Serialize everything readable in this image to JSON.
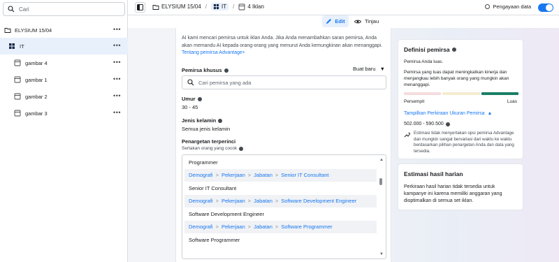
{
  "sidebar": {
    "search_placeholder": "Cari",
    "campaign": "ELYSIUM 15/04",
    "adset": "IT",
    "ads": [
      "gambar 4",
      "gambar 1",
      "gambar 2",
      "gambar 3"
    ],
    "more": "•••"
  },
  "topbar": {
    "campaign": "ELYSIUM 15/04",
    "adset": "IT",
    "ads_count": "4 Iklan",
    "enrichment": "Pengayaan data"
  },
  "modes": {
    "edit": "Edit",
    "review": "Tinjau"
  },
  "form": {
    "intro": "AI kami mencari pemirsa untuk iklan Anda. Jika Anda menambahkan saran pemirsa, Anda akan memandu AI kepada orang-orang yang menurut Anda kemungkinan akan menanggapi.",
    "intro_link": "Tentang pemirsa Advantage+",
    "custom_audience_label": "Pemirsa khusus",
    "create_new": "Buat baru",
    "audience_search_placeholder": "Cari pemirsa yang ada",
    "age_label": "Umur",
    "age_value": "30 - 45",
    "gender_label": "Jenis kelamin",
    "gender_value": "Semua jenis kelamin",
    "detailed_label": "Penargetan terperinci",
    "detailed_sub": "Sertakan orang yang cocok",
    "detailed_rows": [
      {
        "kind": "term",
        "text": "Programmer"
      },
      {
        "kind": "path",
        "parts": [
          "Demografi",
          "Pekerjaan",
          "Jabatan",
          "Senior IT Consultant"
        ]
      },
      {
        "kind": "term",
        "text": "Senior IT Consultant"
      },
      {
        "kind": "path",
        "parts": [
          "Demografi",
          "Pekerjaan",
          "Jabatan",
          "Software Development Engineer"
        ]
      },
      {
        "kind": "term",
        "text": "Software Development Engineer"
      },
      {
        "kind": "path",
        "parts": [
          "Demografi",
          "Pekerjaan",
          "Jabatan",
          "Software Programmer"
        ]
      },
      {
        "kind": "term",
        "text": "Software Programmer"
      }
    ],
    "path_sep": ">"
  },
  "definition_card": {
    "title": "Definisi pemirsa",
    "broad": "Pemirsa Anda luas.",
    "desc": "Pemirsa yang luas dapat meningkatkan kinerja dan menjangkau lebih banyak orang yang mungkin akan menanggapi.",
    "meter_colors": [
      "#f5dcdc",
      "#f4ecd0",
      "#1a7f64"
    ],
    "narrow": "Persempit",
    "wide": "Luas",
    "show_estimate": "Tampilkan Perkiraan Ukuran Pemirsa",
    "range": "502.000 - 590.500",
    "note_before": "Estimasi tidak menyertakan opsi pemirsa ",
    "note_strong": "Advantage",
    "note_after": " dan mungkin sangat bervariasi dari waktu ke waktu berdasarkan pilihan penargetan Anda dan data yang tersedia."
  },
  "daily_card": {
    "title": "Estimasi hasil harian",
    "text": "Perkiraan hasil harian tidak tersedia untuk kampanye ini karena memiliki anggaran yang dioptimalkan di semua set iklan."
  }
}
